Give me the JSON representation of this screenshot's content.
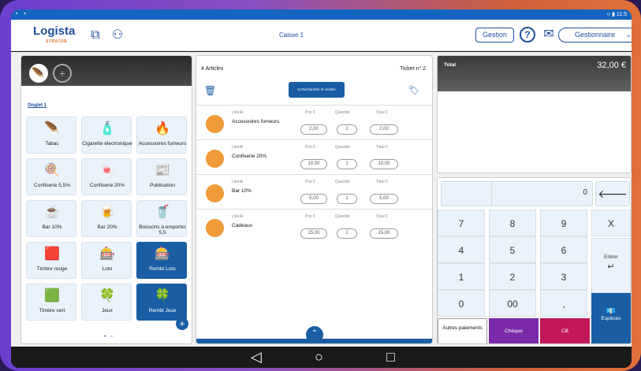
{
  "status": {
    "left": "▪ ▪",
    "right": "‹› ▮ 11:5"
  },
  "appbar": {
    "logo": "Logista",
    "logo_sub": "STRATOR",
    "title": "Caisse 1",
    "gestion": "Gestion",
    "help": "?",
    "profile": "Gestionnaire"
  },
  "catalog": {
    "onglet": "Onglet 1",
    "tiles": [
      {
        "label": "Tabac",
        "icon": "tobacco-leaf-icon",
        "glyph": "🪶",
        "dark": false
      },
      {
        "label": "Cigarette électronique",
        "icon": "ecig-icon",
        "glyph": "🧴",
        "dark": false
      },
      {
        "label": "Accessoires fumeurs",
        "icon": "lighter-icon",
        "glyph": "🔥",
        "dark": false
      },
      {
        "label": "Confiserie 5,5%",
        "icon": "lollipop-icon",
        "glyph": "🍭",
        "dark": false
      },
      {
        "label": "Confiserie 20%",
        "icon": "candy-icon",
        "glyph": "🍬",
        "dark": false
      },
      {
        "label": "Publication",
        "icon": "newspaper-icon",
        "glyph": "📰",
        "dark": false
      },
      {
        "label": "Bar 10%",
        "icon": "coffee-cup-icon",
        "glyph": "☕",
        "dark": false
      },
      {
        "label": "Bar 20%",
        "icon": "beer-icon",
        "glyph": "🍺",
        "dark": false
      },
      {
        "label": "Boissons à emporter 5,5",
        "icon": "takeaway-cup-icon",
        "glyph": "🥤",
        "dark": false
      },
      {
        "label": "Timbre rouge",
        "icon": "stamp-red-icon",
        "glyph": "🟥",
        "dark": false
      },
      {
        "label": "Loto",
        "icon": "loto-icon",
        "glyph": "🎰",
        "dark": false
      },
      {
        "label": "Rembt Loto",
        "icon": "loto-refund-icon",
        "glyph": "🎰",
        "dark": true
      },
      {
        "label": "Timbre vert",
        "icon": "stamp-green-icon",
        "glyph": "🟩",
        "dark": false
      },
      {
        "label": "Jeux",
        "icon": "clover-icon",
        "glyph": "🍀",
        "dark": false
      },
      {
        "label": "Rembt Jeux",
        "icon": "clover-refund-icon",
        "glyph": "🍀",
        "dark": true
      }
    ]
  },
  "ticket": {
    "articles": "4 Articles",
    "ticket_no": "Ticket n° 2",
    "search_label": "Q  Rechercher et vendre",
    "col_libelle": "Libellé",
    "col_prix": "Prix €",
    "col_qte": "Quantité",
    "col_total": "Total €",
    "items": [
      {
        "name": "Accessoires fumeurs",
        "price": "2,00",
        "qty": "1",
        "total": "2,00"
      },
      {
        "name": "Confiserie 20%",
        "price": "10,00",
        "qty": "1",
        "total": "10,00"
      },
      {
        "name": "Bar 10%",
        "price": "5,00",
        "qty": "1",
        "total": "5,00"
      },
      {
        "name": "Cadeaux",
        "price": "15,00",
        "qty": "1",
        "total": "15,00"
      }
    ]
  },
  "total": {
    "label": "Total",
    "amount": "32,00 €"
  },
  "keypad": {
    "display": "0",
    "keys": [
      "7",
      "8",
      "9",
      "X",
      "4",
      "5",
      "6",
      "1",
      "2",
      "3",
      "0",
      "00",
      ","
    ],
    "enter": "Entrer",
    "autres": "Autres paiements",
    "cheque": "Chèque",
    "cb": "CB",
    "especes": "Espèces"
  }
}
